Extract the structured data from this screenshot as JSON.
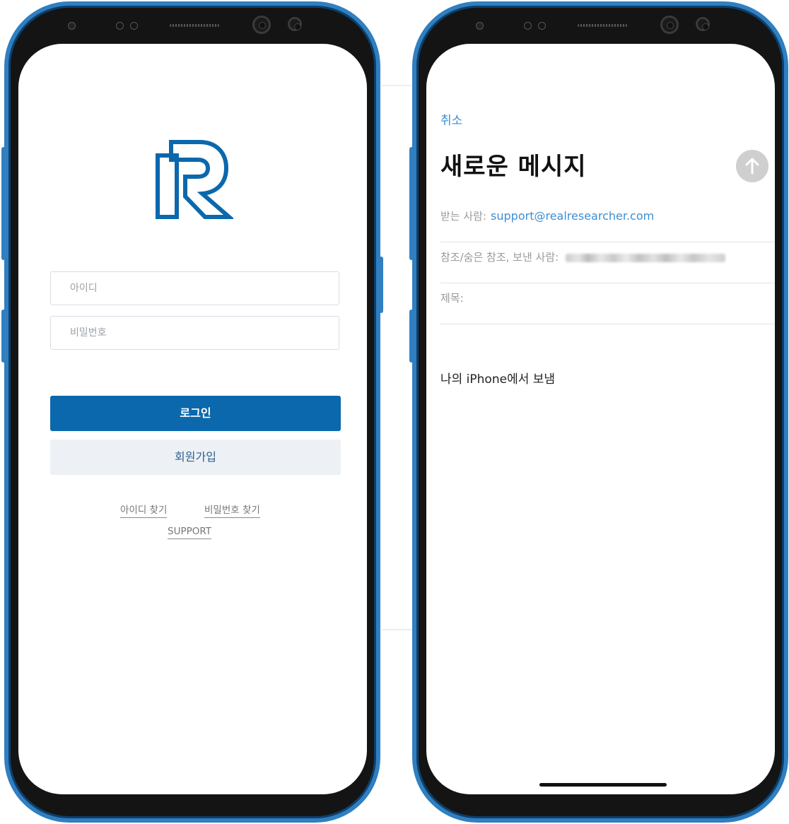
{
  "login_screen": {
    "id_placeholder": "아이디",
    "password_placeholder": "비밀번호",
    "login_label": "로그인",
    "signup_label": "회원가입",
    "find_id_label": "아이디 찾기",
    "find_password_label": "비밀번호 찾기",
    "support_label": "SUPPORT",
    "brand_color": "#0b68ac",
    "logo_icon": "r-logo-icon"
  },
  "mail_screen": {
    "cancel_label": "취소",
    "title": "새로운 메시지",
    "send_icon": "arrow-up-icon",
    "to_label": "받는 사람:",
    "to_value": "support@realresearcher.com",
    "cc_label": "참조/숨은 참조, 보낸 사람:",
    "subject_label": "제목:",
    "signature": "나의 iPhone에서 보냄",
    "accent_color": "#3d8ed3"
  }
}
